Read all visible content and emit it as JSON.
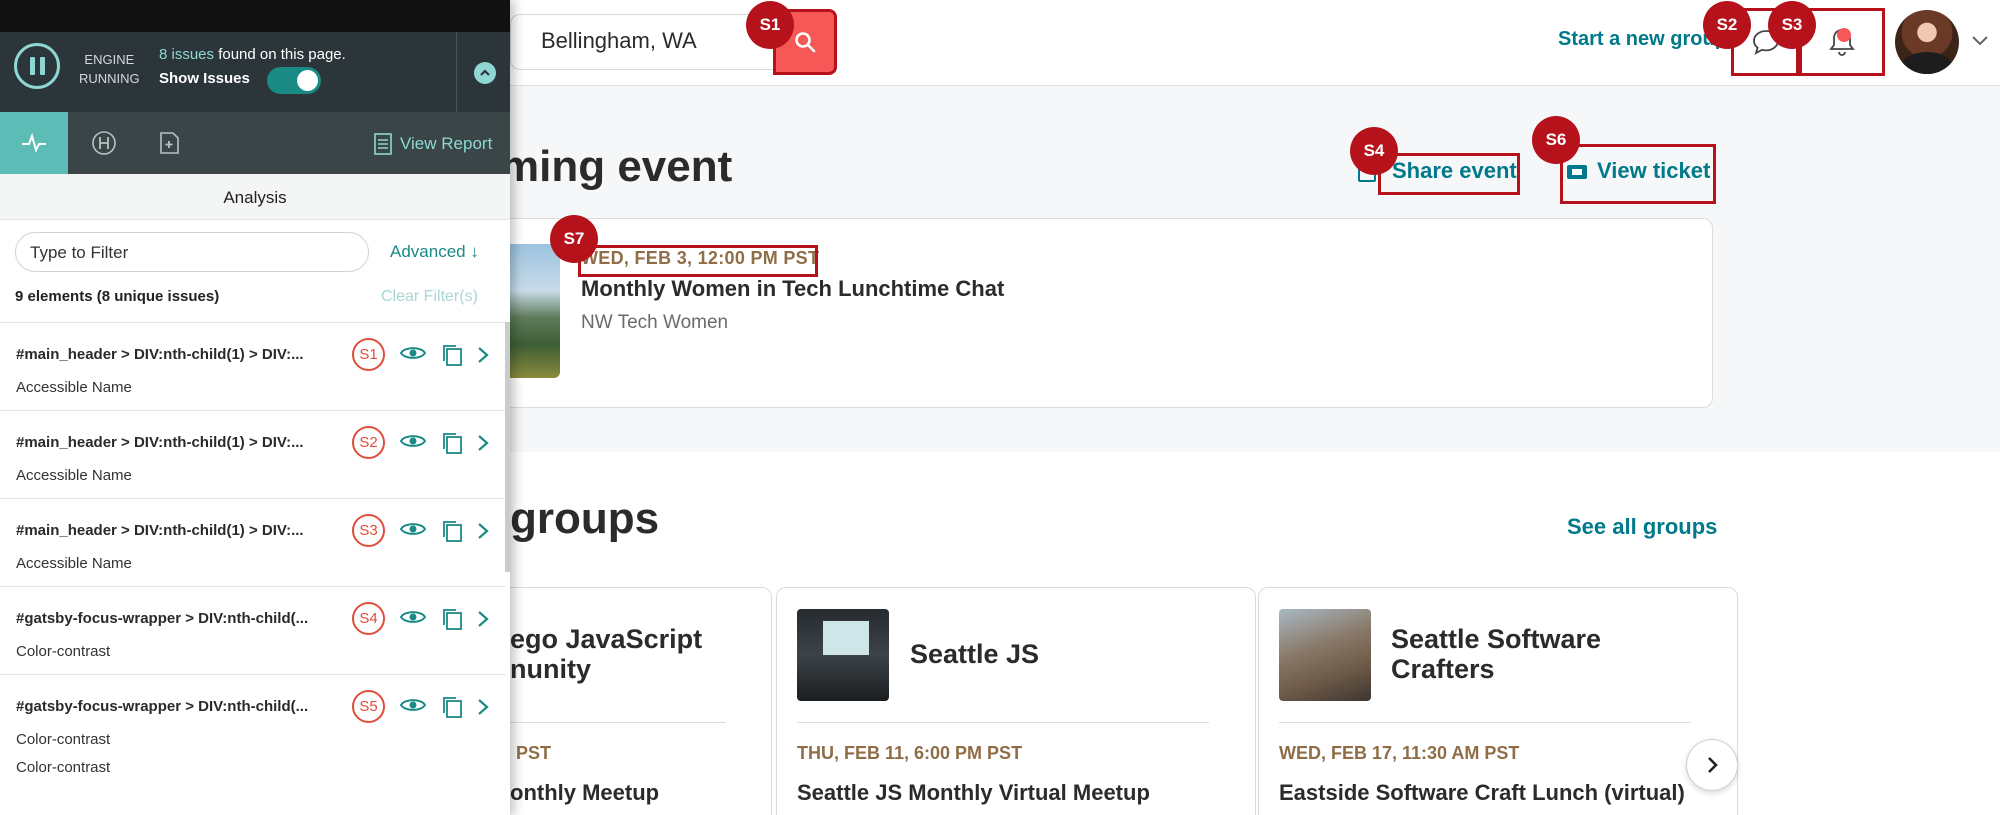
{
  "page": {
    "search": {
      "location_value": "Bellingham, WA"
    },
    "header": {
      "start_group_label": "Start a new group"
    },
    "upcoming": {
      "heading": "ming event",
      "share_label": "Share event",
      "ticket_label": "View ticket",
      "event": {
        "date": "WED, FEB 3, 12:00 PM PST",
        "title": "Monthly Women in Tech Lunchtime Chat",
        "group": "NW Tech Women"
      }
    },
    "groups": {
      "heading": "groups",
      "see_all_label": "See all groups",
      "cards": [
        {
          "name": "ego JavaScript\nnunity",
          "date": "PST",
          "event": "onthly Meetup"
        },
        {
          "name": "Seattle JS",
          "date": "THU, FEB 11, 6:00 PM PST",
          "event": "Seattle JS Monthly Virtual Meetup"
        },
        {
          "name": "Seattle Software\nCrafters",
          "date": "WED, FEB 17, 11:30 AM PST",
          "event": "Eastside Software Craft Lunch (virtual)"
        }
      ]
    }
  },
  "markers": [
    "S1",
    "S2",
    "S3",
    "S4",
    "S6",
    "S7"
  ],
  "panel": {
    "engine_status": "ENGINE\nRUNNING",
    "issues_count": "8 issues",
    "issues_suffix": " found on this page.",
    "show_issues_label": "Show Issues",
    "show_issues_on": true,
    "view_report_label": "View Report",
    "analysis_title": "Analysis",
    "filter_placeholder": "Type to Filter",
    "advanced_label": "Advanced ↓",
    "element_count": "9 elements (8 unique issues)",
    "clear_filters_label": "Clear Filter(s)",
    "issues": [
      {
        "selector": "#main_header > DIV:nth-child(1) > DIV:...",
        "types": [
          "Accessible Name"
        ],
        "badge": "S1"
      },
      {
        "selector": "#main_header > DIV:nth-child(1) > DIV:...",
        "types": [
          "Accessible Name"
        ],
        "badge": "S2"
      },
      {
        "selector": "#main_header > DIV:nth-child(1) > DIV:...",
        "types": [
          "Accessible Name"
        ],
        "badge": "S3"
      },
      {
        "selector": "#gatsby-focus-wrapper > DIV:nth-child(...",
        "types": [
          "Color-contrast"
        ],
        "badge": "S4"
      },
      {
        "selector": "#gatsby-focus-wrapper > DIV:nth-child(...",
        "types": [
          "Color-contrast",
          "Color-contrast"
        ],
        "badge": "S5"
      }
    ]
  },
  "icons": [
    "search-icon",
    "chat-bubble-icon",
    "bell-icon",
    "chevron-down-icon",
    "share-icon",
    "ticket-icon",
    "pause-icon",
    "chevron-up-icon",
    "pulse-icon",
    "heading-icon",
    "add-page-icon",
    "report-icon",
    "eye-icon",
    "copy-icon",
    "chevron-right-icon"
  ],
  "colors": {
    "brand_teal": "#00798a",
    "search_red": "#f65858",
    "marker_red": "#b5121b",
    "panel_dark": "#2c3539",
    "panel_accent": "#8ed7d3",
    "date_brown": "#8f6e47"
  }
}
